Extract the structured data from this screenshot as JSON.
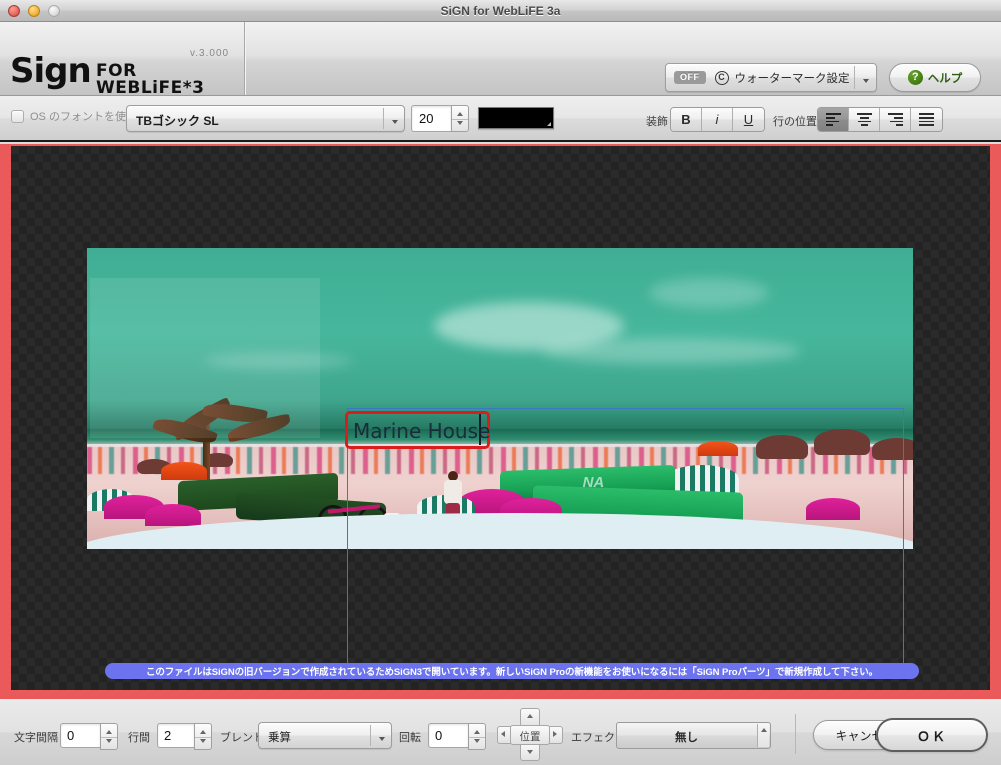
{
  "window": {
    "title": "SiGN for WebLiFE 3a",
    "controls": {
      "close": "close",
      "minimize": "minimize",
      "zoom": "zoom"
    }
  },
  "header": {
    "logo_main": "Sign",
    "logo_sub": "FOR WEBLiFE*3",
    "version": "v.3.000",
    "watermark": {
      "state_badge": "OFF",
      "label": "ウォーターマーク設定",
      "copyright_icon": "C"
    },
    "help": {
      "label": "ヘルプ",
      "icon": "?"
    }
  },
  "toolbar": {
    "os_font_checkbox_label": "OS のフォントを使用",
    "os_font_checked": false,
    "font_name": "TBゴシック SL",
    "font_size": "20",
    "text_color": "#000000",
    "decoration_label": "装飾",
    "decoration_buttons": [
      {
        "name": "bold",
        "glyph": "B"
      },
      {
        "name": "italic",
        "glyph": "i"
      },
      {
        "name": "underline",
        "glyph": "U"
      }
    ],
    "line_position_label": "行の位置",
    "align_buttons": [
      {
        "name": "align-left",
        "active": true
      },
      {
        "name": "align-center",
        "active": false
      },
      {
        "name": "align-right",
        "active": false
      },
      {
        "name": "align-justify",
        "active": false
      }
    ]
  },
  "canvas": {
    "border_color": "#ea5a5a",
    "text_object": {
      "value": "Marine House",
      "font_size_px": 20,
      "color": "#1b2b3a",
      "selection_border_color": "#d91d1d"
    },
    "image_object": {
      "selection_border_color": "#3d76c4",
      "tent_label": "NA"
    },
    "notice": {
      "message": "このファイルはSiGNの旧バージョンで作成されているためSiGN3で開いています。新しいSiGN Proの新機能をお使いになるには「SiGN Proパーツ」で新規作成して下さい。",
      "background_color": "#6b74ee",
      "text_color": "#ffffff"
    }
  },
  "bottombar": {
    "char_spacing_label": "文字間隔",
    "char_spacing_value": "0",
    "line_spacing_label": "行間",
    "line_spacing_value": "2",
    "blend_label": "ブレンド",
    "blend_value": "乗算",
    "rotation_label": "回転",
    "rotation_value": "0",
    "position_label": "位置",
    "effect_label": "エフェクト",
    "effect_value": "無し",
    "cancel_label": "キャンセル",
    "ok_label": "ＯＫ"
  }
}
